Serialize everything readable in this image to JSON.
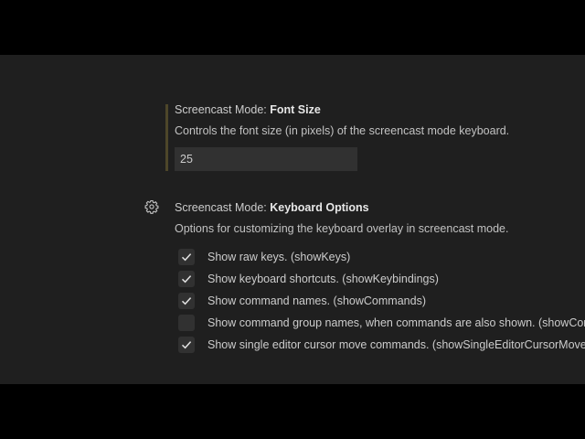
{
  "font_size_setting": {
    "category": "Screencast Mode: ",
    "name": "Font Size",
    "description": "Controls the font size (in pixels) of the screencast mode keyboard.",
    "value": "25"
  },
  "keyboard_options_setting": {
    "category": "Screencast Mode: ",
    "name": "Keyboard Options",
    "description": "Options for customizing the keyboard overlay in screencast mode.",
    "options": [
      {
        "label": "Show raw keys. (showKeys)",
        "checked": true
      },
      {
        "label": "Show keyboard shortcuts. (showKeybindings)",
        "checked": true
      },
      {
        "label": "Show command names. (showCommands)",
        "checked": true
      },
      {
        "label": "Show command group names, when commands are also shown. (showCommandGroups)",
        "checked": false
      },
      {
        "label": "Show single editor cursor move commands. (showSingleEditorCursorMoves)",
        "checked": true
      }
    ]
  },
  "icons": {
    "gear": "gear-icon",
    "check": "check-icon"
  },
  "colors": {
    "background": "#1f1f1f",
    "input_background": "#313131",
    "focus_indicator": "#4d4629",
    "text": "#cccccc"
  }
}
